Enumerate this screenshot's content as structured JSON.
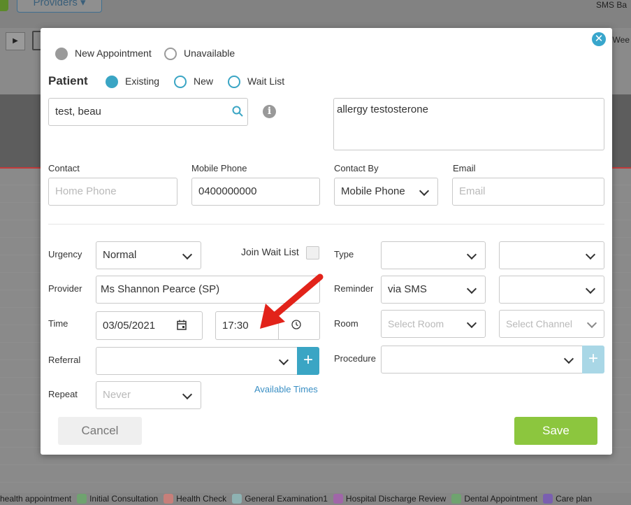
{
  "background": {
    "providers_button": "Providers",
    "sms_label": "SMS Ba",
    "week_label": "Wee",
    "legend": [
      {
        "label": "health appointment",
        "color": "#7fae8a"
      },
      {
        "label": "Initial Consultation",
        "color": "#6fa36f"
      },
      {
        "label": "Health Check",
        "color": "#c77f7a"
      },
      {
        "label": "General Examination1",
        "color": "#8eb2b2"
      },
      {
        "label": "Hospital Discharge Review",
        "color": "#a066a8"
      },
      {
        "label": "Dental Appointment",
        "color": "#6fa36f"
      },
      {
        "label": "Care plan",
        "color": "#7a5fb0"
      }
    ]
  },
  "modal": {
    "close_icon": "close-circle-icon",
    "appointment_type": {
      "new_appointment": "New Appointment",
      "unavailable": "Unavailable",
      "selected": "New Appointment"
    },
    "patient": {
      "heading": "Patient",
      "existing": "Existing",
      "new": "New",
      "wait_list": "Wait List",
      "selected": "Existing",
      "search_value": "test, beau",
      "notes": "allergy testosterone"
    },
    "contact": {
      "contact_label": "Contact",
      "contact_placeholder": "Home Phone",
      "mobile_label": "Mobile Phone",
      "mobile_value": "0400000000",
      "contact_by_label": "Contact By",
      "contact_by_value": "Mobile Phone",
      "email_label": "Email",
      "email_placeholder": "Email"
    },
    "left": {
      "urgency_label": "Urgency",
      "urgency_value": "Normal",
      "join_wait_list_label": "Join Wait List",
      "provider_label": "Provider",
      "provider_value": "Ms Shannon Pearce (SP)",
      "time_label": "Time",
      "date_value": "03/05/2021",
      "time_value": "17:30",
      "referral_label": "Referral",
      "referral_value": "",
      "repeat_label": "Repeat",
      "repeat_value": "Never",
      "available_times_link": "Available Times"
    },
    "right": {
      "type_label": "Type",
      "reminder_label": "Reminder",
      "reminder_value": "via SMS",
      "room_label": "Room",
      "room_placeholder": "Select Room",
      "channel_placeholder": "Select Channel",
      "procedure_label": "Procedure"
    },
    "buttons": {
      "cancel": "Cancel",
      "save": "Save"
    },
    "colors": {
      "accent": "#3aa5c4",
      "save": "#8cc63e",
      "annotation_arrow": "#e2231a"
    }
  }
}
